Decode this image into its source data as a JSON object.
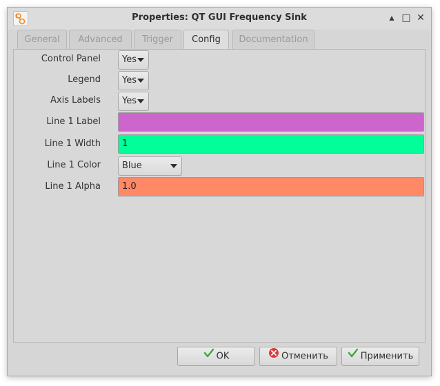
{
  "window": {
    "title": "Properties: QT GUI Frequency Sink",
    "controls": {
      "minimize": "▴",
      "maximize": "□",
      "close": "✕"
    }
  },
  "tabs": [
    {
      "label": "General",
      "active": false
    },
    {
      "label": "Advanced",
      "active": false
    },
    {
      "label": "Trigger",
      "active": false
    },
    {
      "label": "Config",
      "active": true
    },
    {
      "label": "Documentation",
      "active": false
    }
  ],
  "fields": {
    "control_panel": {
      "label": "Control Panel",
      "value": "Yes"
    },
    "legend": {
      "label": "Legend",
      "value": "Yes"
    },
    "axis_labels": {
      "label": "Axis Labels",
      "value": "Yes"
    },
    "line1_label": {
      "label": "Line 1 Label",
      "value": "",
      "bg": "#cc66cc"
    },
    "line1_width": {
      "label": "Line 1 Width",
      "value": "1",
      "bg": "#00ff99"
    },
    "line1_color": {
      "label": "Line 1 Color",
      "value": "Blue"
    },
    "line1_alpha": {
      "label": "Line 1 Alpha",
      "value": "1.0",
      "bg": "#ff8866"
    }
  },
  "buttons": {
    "ok": "OK",
    "cancel": "Отменить",
    "apply": "Применить"
  },
  "icons": {
    "app": "gnuradio-icon",
    "ok": "checkmark-icon",
    "cancel": "cancel-icon",
    "apply": "checkmark-icon"
  }
}
